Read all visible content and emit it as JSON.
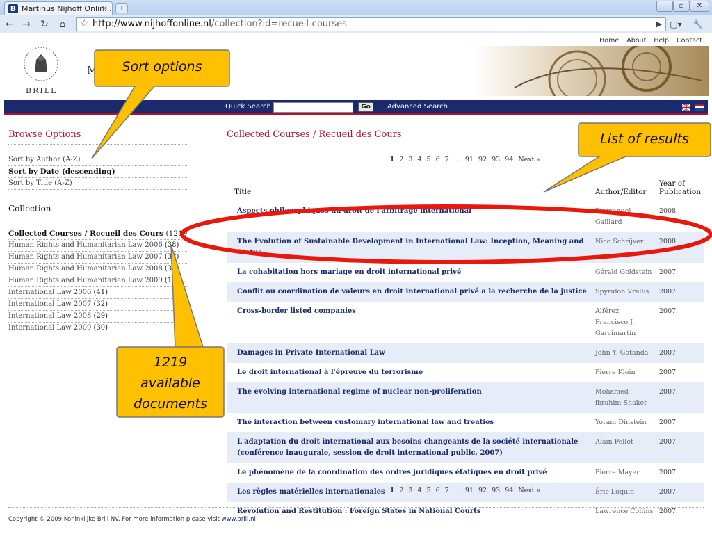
{
  "browser": {
    "tab_title": "Martinus Nijhoff Onlin...",
    "tab_close": "×",
    "newtab": "+",
    "url_host": "http://www.nijhoffonline.nl",
    "url_path": "/collection?id=recueil-courses"
  },
  "header": {
    "nav": [
      "Home",
      "About",
      "Help",
      "Contact"
    ],
    "brand": "BRILL",
    "title_initial": "M",
    "quick_search_label": "Quick Search",
    "go_label": "Go",
    "advanced_search": "Advanced Search"
  },
  "sidebar": {
    "browse_title": "Browse Options",
    "sort_options": [
      {
        "label": "Sort by Author (A-Z)",
        "active": false
      },
      {
        "label": "Sort by Date (descending)",
        "active": true
      },
      {
        "label": "Sort by Title (A-Z)",
        "active": false
      }
    ],
    "collection_title": "Collection",
    "collections": [
      {
        "label": "Collected Courses / Recueil des Cours",
        "count": "(1219)",
        "active": true
      },
      {
        "label": "Human Rights and Humanitarian Law 2006",
        "count": "(38)"
      },
      {
        "label": "Human Rights and Humanitarian Law 2007",
        "count": "(38)"
      },
      {
        "label": "Human Rights and Humanitarian Law 2008",
        "count": "(35)"
      },
      {
        "label": "Human Rights and Humanitarian Law 2009",
        "count": "(14)"
      },
      {
        "label": "International Law 2006",
        "count": "(41)"
      },
      {
        "label": "International Law 2007",
        "count": "(32)"
      },
      {
        "label": "International Law 2008",
        "count": "(29)"
      },
      {
        "label": "International Law 2009",
        "count": "(30)"
      }
    ]
  },
  "main": {
    "heading": "Collected Courses / Recueil des Cours",
    "pager": [
      "1",
      "2",
      "3",
      "4",
      "5",
      "6",
      "7",
      "...",
      "91",
      "92",
      "93",
      "94",
      "Next »"
    ],
    "columns": {
      "title": "Title",
      "author": "Author/Editor",
      "year_line1": "Year of",
      "year_line2": "Publication"
    },
    "rows": [
      {
        "title": "Aspects philosophiques du droit de l'arbitrage international",
        "author": "Emmanuel Gaillard",
        "year": "2008"
      },
      {
        "title": "The Evolution of Sustainable Development in International Law: Inception, Meaning and Status",
        "author": "Nico Schrijver",
        "year": "2008"
      },
      {
        "title": "La cohabitation hors mariage en droit international privé",
        "author": "Gérald Goldstein",
        "year": "2007"
      },
      {
        "title": "Conflit ou coordination de valeurs en droit international privé a la recherche de la justice",
        "author": "Spyridon Vrellis",
        "year": "2007"
      },
      {
        "title": "Cross-border listed companies",
        "author": "Alférez Francisco J. Garcimartín",
        "year": "2007"
      },
      {
        "title": "Damages in Private International Law",
        "author": "John Y. Gotanda",
        "year": "2007"
      },
      {
        "title": "Le droit international à l'épreuve du terrorisme",
        "author": "Pierre Klein",
        "year": "2007"
      },
      {
        "title": "The evolving international regime of nuclear non-proliferation",
        "author": "Mohamed ibrahim Shaker",
        "year": "2007"
      },
      {
        "title": "The interaction between customary international law and treaties",
        "author": "Yoram Dinstein",
        "year": "2007"
      },
      {
        "title": "L'adaptation du droit international aux besoins changeants de la société internationale (conférence inaugurale, session de droit international public, 2007)",
        "author": "Alain Pellet",
        "year": "2007"
      },
      {
        "title": "Le phénomène de la coordination des ordres juridiques étatiques en droit privé",
        "author": "Pierre Mayer",
        "year": "2007"
      },
      {
        "title": "Les règles matérielles internationales",
        "author": "Éric Loquin",
        "year": "2007"
      },
      {
        "title": "Revolution and Restitution : Foreign States in National Courts",
        "author": "Lawrence Collins",
        "year": "2007"
      }
    ]
  },
  "footer": {
    "text": "Copyright © 2009 Koninklijke Brill NV. For more information please visit ",
    "link": "www.brill.nl"
  },
  "callouts": {
    "sort": "Sort options",
    "results": "List of results",
    "docs_line1": "1219",
    "docs_line2": "available",
    "docs_line3": "documents"
  },
  "colors": {
    "nav_bar": "#1a2a6c",
    "accent_red": "#b3102a",
    "callout_fill": "#ffc000",
    "ellipse": "#e8190c",
    "row_alt": "#e6ecf8"
  }
}
